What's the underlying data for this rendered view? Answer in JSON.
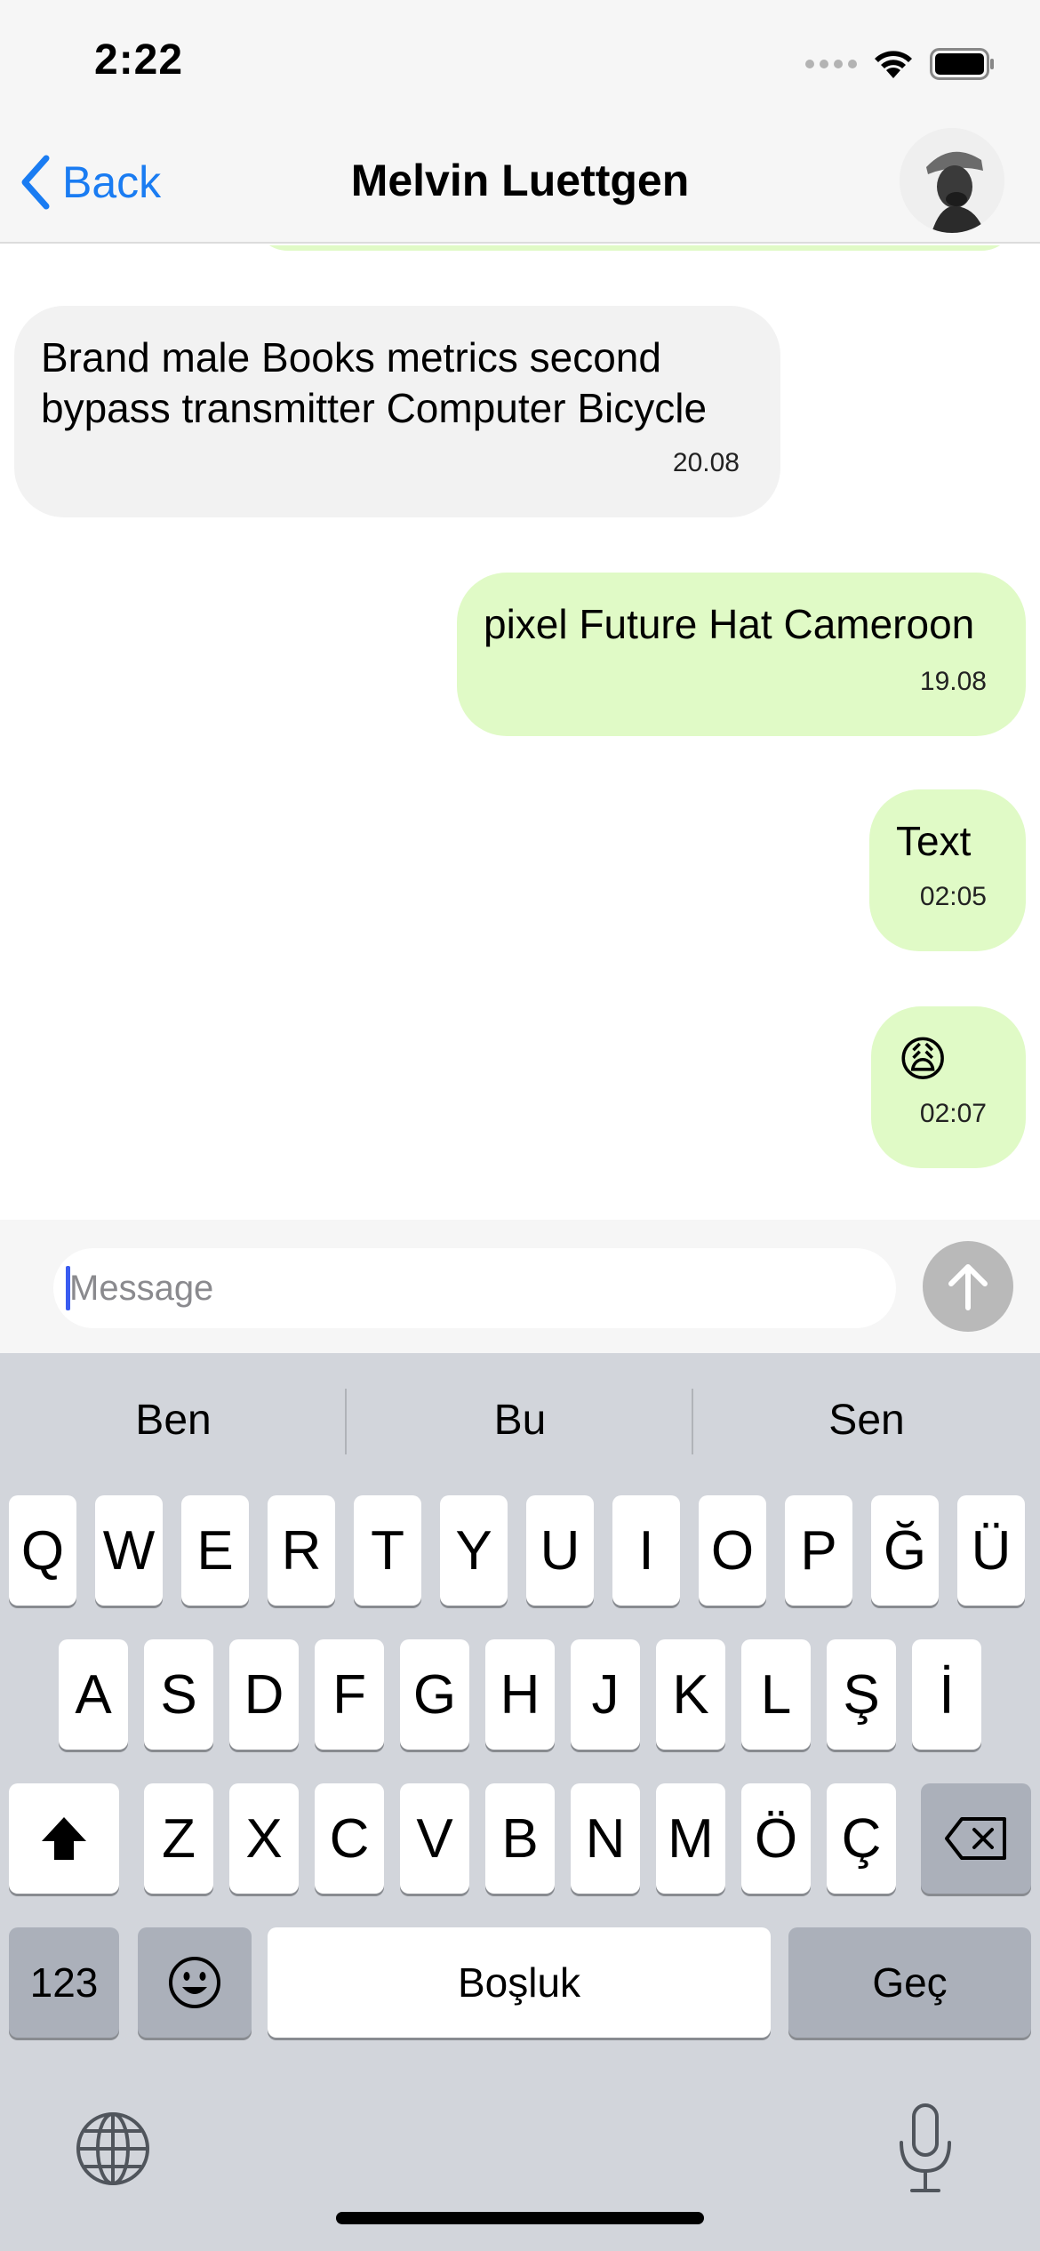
{
  "status_bar": {
    "time": "2:22"
  },
  "nav": {
    "back_label": "Back",
    "title": "Melvin Luettgen"
  },
  "messages": [
    {
      "direction": "incoming",
      "text": "Brand male Books metrics second\nbypass transmitter Computer Bicycle",
      "time": "20.08"
    },
    {
      "direction": "outgoing",
      "text": "pixel Future Hat Cameroon",
      "time": "19.08"
    },
    {
      "direction": "outgoing",
      "text": "Text",
      "time": "02:05"
    },
    {
      "direction": "outgoing",
      "text": "😩",
      "time": "02:07"
    }
  ],
  "input": {
    "placeholder": "Message",
    "value": ""
  },
  "keyboard": {
    "suggestions": [
      "Ben",
      "Bu",
      "Sen"
    ],
    "row1": [
      "Q",
      "W",
      "E",
      "R",
      "T",
      "Y",
      "U",
      "I",
      "O",
      "P",
      "Ğ",
      "Ü"
    ],
    "row2": [
      "A",
      "S",
      "D",
      "F",
      "G",
      "H",
      "J",
      "K",
      "L",
      "Ş",
      "İ"
    ],
    "row3": [
      "Z",
      "X",
      "C",
      "V",
      "B",
      "N",
      "M",
      "Ö",
      "Ç"
    ],
    "numbers_label": "123",
    "space_label": "Boşluk",
    "return_label": "Geç"
  },
  "icons": {
    "back": "chevron-left-icon",
    "send": "arrow-up-icon",
    "shift": "shift-icon",
    "delete": "delete-icon",
    "emoji": "emoji-icon",
    "globe": "globe-icon",
    "mic": "microphone-icon",
    "wifi": "wifi-icon",
    "battery": "battery-icon"
  },
  "colors": {
    "accent": "#1a7cf2",
    "outgoing_bubble": "#e0fac6",
    "incoming_bubble": "#f2f2f2",
    "keyboard_bg": "#d2d5db"
  }
}
